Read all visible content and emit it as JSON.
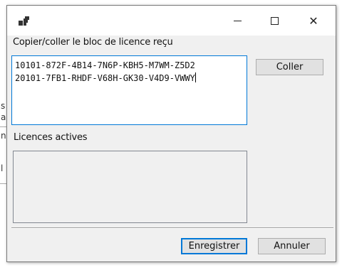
{
  "window": {
    "controls": {
      "minimize_icon": "minimize-icon",
      "maximize_icon": "maximize-icon",
      "close_glyph": "✕"
    }
  },
  "license_input": {
    "label": "Copier/coller le bloc de licence reçu",
    "value": "10101-872F-4B14-7N6P-KBH5-M7WM-Z5D2\n20101-7FB1-RHDF-V68H-GK30-V4D9-VWWY"
  },
  "paste_button": {
    "label": "Coller"
  },
  "active_licenses": {
    "label": "Licences actives",
    "items": []
  },
  "footer": {
    "save_label": "Enregistrer",
    "cancel_label": "Annuler"
  },
  "background_window": {
    "chars": [
      "s",
      "a",
      "n",
      "l"
    ]
  },
  "colors": {
    "accent": "#0078d7",
    "dialog_bg": "#f0f0f0",
    "button_bg": "#e1e1e1"
  }
}
